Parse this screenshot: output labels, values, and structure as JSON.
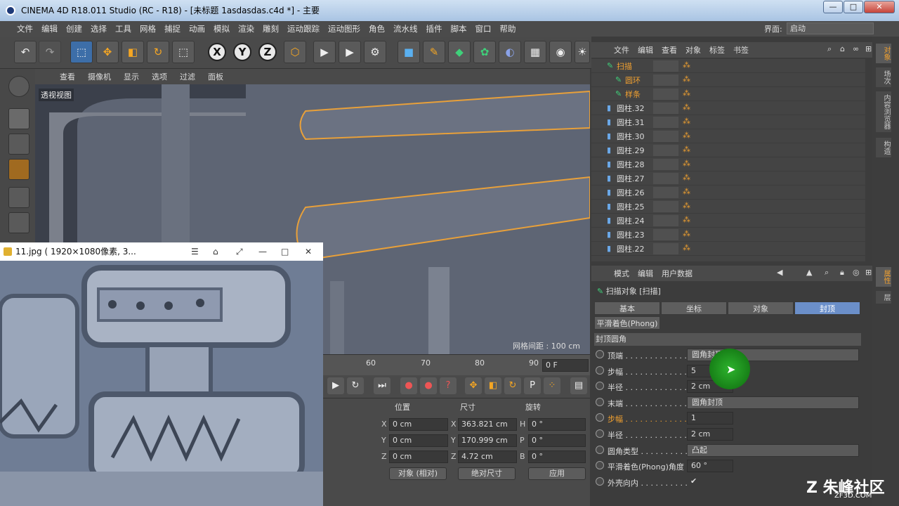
{
  "window": {
    "title": "CINEMA 4D R18.011 Studio (RC - R18) - [未标题 1asdasdas.c4d *] - 主要",
    "minimize": "—",
    "maximize": "□",
    "close": "✕"
  },
  "menu": [
    "文件",
    "编辑",
    "创建",
    "选择",
    "工具",
    "网格",
    "捕捉",
    "动画",
    "模拟",
    "渲染",
    "雕刻",
    "运动跟踪",
    "运动图形",
    "角色",
    "流水线",
    "插件",
    "脚本",
    "窗口",
    "帮助"
  ],
  "interface": {
    "label": "界面:",
    "value": "启动"
  },
  "axes": {
    "x": "X",
    "y": "Y",
    "z": "Z"
  },
  "viewport": {
    "menu": [
      "查看",
      "摄像机",
      "显示",
      "选项",
      "过滤",
      "面板"
    ],
    "label": "透视视图",
    "grid": "网格间距 : 100 cm"
  },
  "timeline": {
    "ticks": [
      "60",
      "70",
      "80",
      "90"
    ],
    "frame": "0 F"
  },
  "coords": {
    "headers": [
      "位置",
      "尺寸",
      "旋转"
    ],
    "pos": [
      {
        "axis": "X",
        "value": "0 cm"
      },
      {
        "axis": "Y",
        "value": "0 cm"
      },
      {
        "axis": "Z",
        "value": "0 cm"
      }
    ],
    "size": [
      {
        "axis": "X",
        "value": "363.821 cm"
      },
      {
        "axis": "Y",
        "value": "170.999 cm"
      },
      {
        "axis": "Z",
        "value": "4.72 cm"
      }
    ],
    "rot": [
      {
        "axis": "H",
        "value": "0 °"
      },
      {
        "axis": "P",
        "value": "0 °"
      },
      {
        "axis": "B",
        "value": "0 °"
      }
    ],
    "mode": "对象 (相对)",
    "size_mode": "绝对尺寸",
    "apply": "应用"
  },
  "photo": {
    "title": "11.jpg ( 1920×1080像素, 3..."
  },
  "object_manager": {
    "menu": [
      "文件",
      "编辑",
      "查看",
      "对象",
      "标签",
      "书签"
    ],
    "objects": [
      {
        "name": "扫描",
        "indent": 0,
        "highlight": true
      },
      {
        "name": "圆环",
        "indent": 1,
        "highlight": true
      },
      {
        "name": "样条",
        "indent": 1,
        "highlight": true
      },
      {
        "name": "圆柱.32",
        "indent": 0
      },
      {
        "name": "圆柱.31",
        "indent": 0
      },
      {
        "name": "圆柱.30",
        "indent": 0
      },
      {
        "name": "圆柱.29",
        "indent": 0
      },
      {
        "name": "圆柱.28",
        "indent": 0
      },
      {
        "name": "圆柱.27",
        "indent": 0
      },
      {
        "name": "圆柱.26",
        "indent": 0
      },
      {
        "name": "圆柱.25",
        "indent": 0
      },
      {
        "name": "圆柱.24",
        "indent": 0
      },
      {
        "name": "圆柱.23",
        "indent": 0
      },
      {
        "name": "圆柱.22",
        "indent": 0
      }
    ]
  },
  "attributes": {
    "menu": [
      "模式",
      "编辑",
      "用户数据"
    ],
    "title": "扫描对象 [扫描]",
    "tabs": [
      "基本",
      "坐标",
      "对象",
      "封顶"
    ],
    "active_tab": "封顶",
    "phong_tab": "平滑着色(Phong)",
    "section": "封顶圆角",
    "rows": [
      {
        "label": "顶端 . . . . . . . . . . . . .",
        "type": "drop",
        "value": "圆角封顶"
      },
      {
        "label": "步幅 . . . . . . . . . . . . .",
        "type": "num",
        "value": "5"
      },
      {
        "label": "半径 . . . . . . . . . . . . .",
        "type": "num",
        "value": "2 cm"
      },
      {
        "label": "末端 . . . . . . . . . . . . .",
        "type": "drop",
        "value": "圆角封顶"
      },
      {
        "label": "步幅 . . . . . . . . . . . . .",
        "type": "num",
        "value": "1",
        "highlight": true
      },
      {
        "label": "半径 . . . . . . . . . . . . .",
        "type": "num",
        "value": "2 cm"
      },
      {
        "label": "圆角类型 . . . . . . . . . .",
        "type": "drop",
        "value": "凸起"
      },
      {
        "label": "平滑着色(Phong)角度",
        "type": "num",
        "value": "60 °"
      },
      {
        "label": "外壳向内 . . . . . . . . . .",
        "type": "check",
        "value": "✔"
      }
    ]
  },
  "side_tabs": [
    "对象",
    "场次",
    "内容浏览器",
    "构造",
    "属性",
    "层"
  ],
  "watermark": {
    "brand": "Z 朱峰社区",
    "site": "ZF3D.COM"
  }
}
